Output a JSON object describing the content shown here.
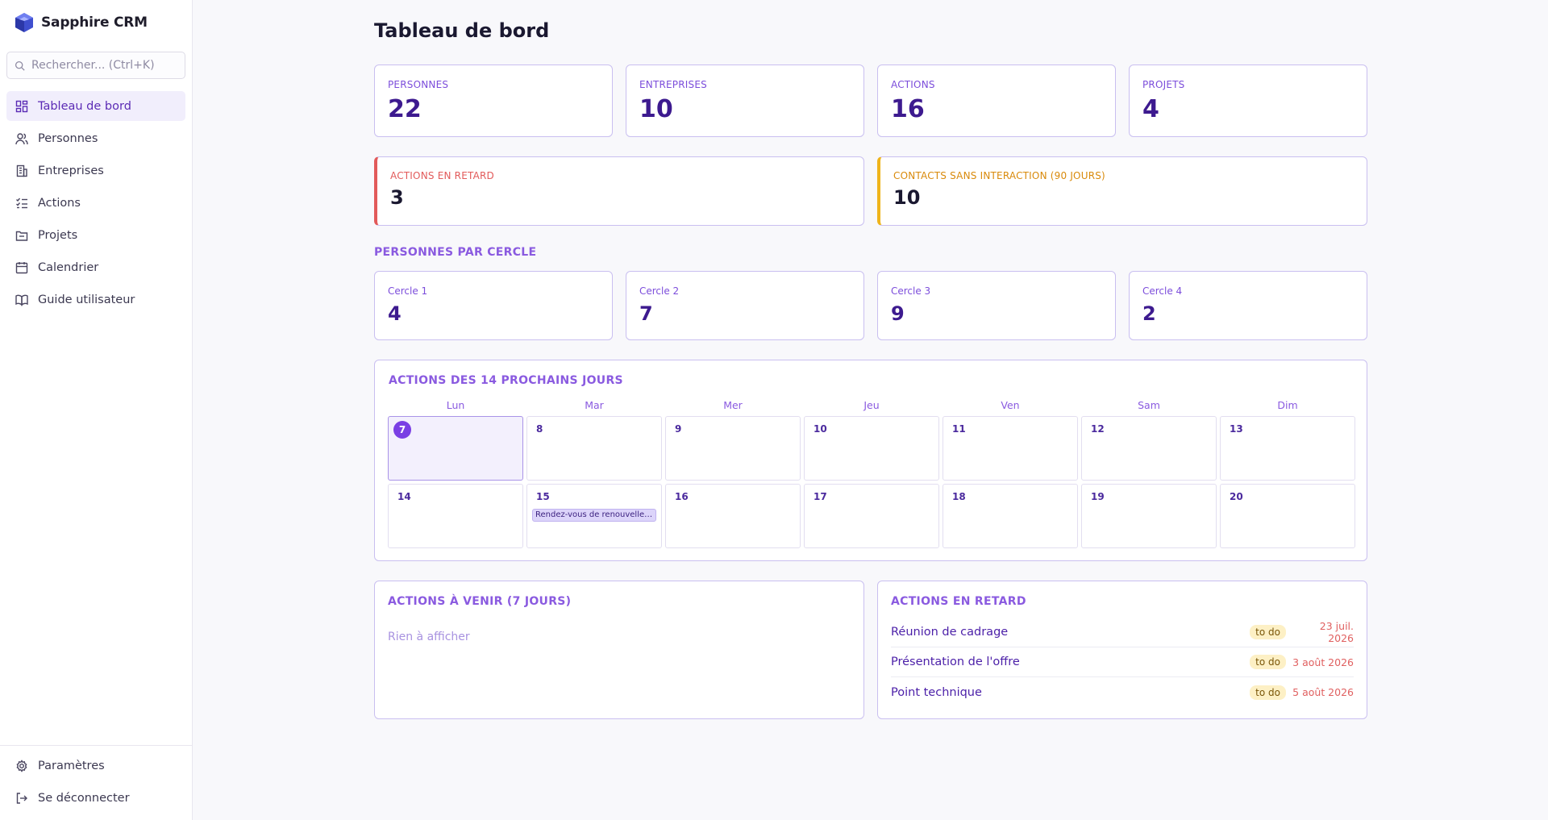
{
  "app": {
    "name": "Sapphire CRM",
    "search_placeholder": "Rechercher... (Ctrl+K)"
  },
  "sidebar": {
    "items": [
      {
        "label": "Tableau de bord",
        "icon": "dashboard-icon",
        "active": true
      },
      {
        "label": "Personnes",
        "icon": "users-icon"
      },
      {
        "label": "Entreprises",
        "icon": "building-icon"
      },
      {
        "label": "Actions",
        "icon": "checklist-icon"
      },
      {
        "label": "Projets",
        "icon": "folder-icon"
      },
      {
        "label": "Calendrier",
        "icon": "calendar-icon"
      },
      {
        "label": "Guide utilisateur",
        "icon": "book-icon"
      }
    ],
    "bottom": [
      {
        "label": "Paramètres",
        "icon": "gear-icon"
      },
      {
        "label": "Se déconnecter",
        "icon": "logout-icon"
      }
    ]
  },
  "page": {
    "title": "Tableau de bord"
  },
  "stats": [
    {
      "label": "PERSONNES",
      "value": "22"
    },
    {
      "label": "ENTREPRISES",
      "value": "10"
    },
    {
      "label": "ACTIONS",
      "value": "16"
    },
    {
      "label": "PROJETS",
      "value": "4"
    }
  ],
  "alerts": [
    {
      "label": "ACTIONS EN RETARD",
      "value": "3",
      "color": "#e25a5a"
    },
    {
      "label": "CONTACTS SANS INTERACTION (90 JOURS)",
      "value": "10",
      "color": "#d98a0b"
    }
  ],
  "circles": {
    "title": "PERSONNES PAR CERCLE",
    "items": [
      {
        "label": "Cercle 1",
        "value": "4"
      },
      {
        "label": "Cercle 2",
        "value": "7"
      },
      {
        "label": "Cercle 3",
        "value": "9"
      },
      {
        "label": "Cercle 4",
        "value": "2"
      }
    ]
  },
  "calendar": {
    "title": "ACTIONS DES 14 PROCHAINS JOURS",
    "weekdays": [
      "Lun",
      "Mar",
      "Mer",
      "Jeu",
      "Ven",
      "Sam",
      "Dim"
    ],
    "days": [
      "7",
      "8",
      "9",
      "10",
      "11",
      "12",
      "13",
      "14",
      "15",
      "16",
      "17",
      "18",
      "19",
      "20"
    ],
    "today": "7",
    "events": [
      {
        "day": "15",
        "label": "Rendez-vous de renouvellement"
      }
    ]
  },
  "upcoming": {
    "title": "ACTIONS À VENIR (7 JOURS)",
    "empty_text": "Rien à afficher"
  },
  "late": {
    "title": "ACTIONS EN RETARD",
    "items": [
      {
        "title": "Réunion de cadrage",
        "status": "to do",
        "date": "23 juil. 2026"
      },
      {
        "title": "Présentation de l'offre",
        "status": "to do",
        "date": "3 août 2026"
      },
      {
        "title": "Point technique",
        "status": "to do",
        "date": "5 août 2026"
      }
    ]
  },
  "colors": {
    "accent": "#7a3fe4",
    "border": "#c9bff0",
    "danger": "#e25a5a",
    "warning": "#efb41b"
  }
}
